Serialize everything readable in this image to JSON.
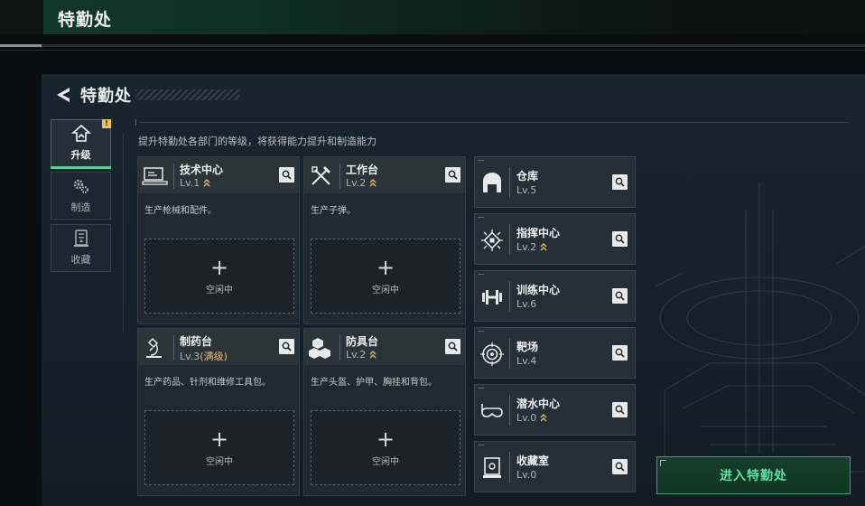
{
  "header": {
    "title": "特勤处"
  },
  "panel": {
    "title": "特勤处",
    "subtitle": "提升特勤处各部门的等级，将获得能力提升和制造能力"
  },
  "tabs": [
    {
      "label": "升级",
      "icon": "upgrade-icon",
      "active": true,
      "badge": "!"
    },
    {
      "label": "制造",
      "icon": "gears-icon",
      "active": false
    },
    {
      "label": "收藏",
      "icon": "collection-icon",
      "active": false
    }
  ],
  "cards": [
    {
      "name": "技术中心",
      "level": "Lv.1",
      "max_tag": "",
      "upgradable": true,
      "desc": "生产枪械和配件。",
      "icon": "computer-icon",
      "slot": {
        "plus": "+",
        "status": "空闲中"
      }
    },
    {
      "name": "工作台",
      "level": "Lv.2",
      "max_tag": "",
      "upgradable": true,
      "desc": "生产子弹。",
      "icon": "tools-icon",
      "slot": {
        "plus": "+",
        "status": "空闲中"
      }
    },
    {
      "name": "制药台",
      "level": "Lv.3",
      "max_tag": "(满级)",
      "upgradable": false,
      "desc": "生产药品、针剂和维修工具包。",
      "icon": "microscope-icon",
      "slot": {
        "plus": "+",
        "status": "空闲中"
      }
    },
    {
      "name": "防具台",
      "level": "Lv.2",
      "max_tag": "",
      "upgradable": true,
      "desc": "生产头盔、护甲、胸挂和背包。",
      "icon": "armor-blocks-icon",
      "slot": {
        "plus": "+",
        "status": "空闲中"
      }
    }
  ],
  "facilities": [
    {
      "name": "仓库",
      "level": "Lv.5",
      "upgradable": false,
      "icon": "warehouse-icon"
    },
    {
      "name": "指挥中心",
      "level": "Lv.2",
      "upgradable": true,
      "icon": "chip-icon"
    },
    {
      "name": "训练中心",
      "level": "Lv.6",
      "upgradable": false,
      "icon": "dumbbell-icon"
    },
    {
      "name": "靶场",
      "level": "Lv.4",
      "upgradable": false,
      "icon": "target-icon"
    },
    {
      "name": "潜水中心",
      "level": "Lv.0",
      "upgradable": true,
      "icon": "diving-mask-icon"
    },
    {
      "name": "收藏室",
      "level": "Lv.0",
      "upgradable": false,
      "icon": "display-case-icon"
    }
  ],
  "enter_button": {
    "label": "进入特勤处"
  },
  "colors": {
    "accent_green": "#5ecf9a",
    "upgrade_gold": "#e9b860",
    "badge_yellow": "#e9c550"
  }
}
